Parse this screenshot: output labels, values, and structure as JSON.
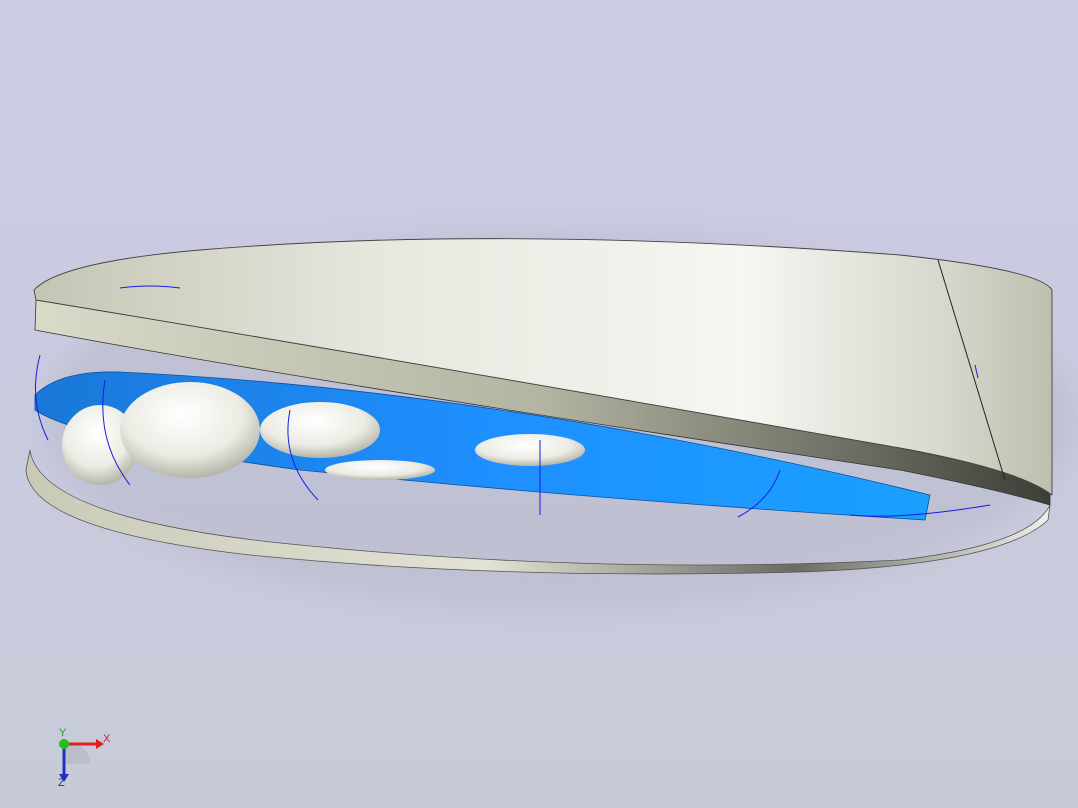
{
  "viewport": {
    "background_top": "#cccce6",
    "background_bottom": "#c8ccd8"
  },
  "model": {
    "ring_color": "#dcdcd0",
    "cage_color": "#1e90ff",
    "ball_color": "#f4f4ee",
    "edge_color": "#1a1ae6"
  },
  "axis_triad": {
    "x_label": "X",
    "y_label": "Y",
    "z_label": "Z",
    "x_color": "#e02020",
    "y_color": "#20c020",
    "z_color": "#2030c0"
  }
}
